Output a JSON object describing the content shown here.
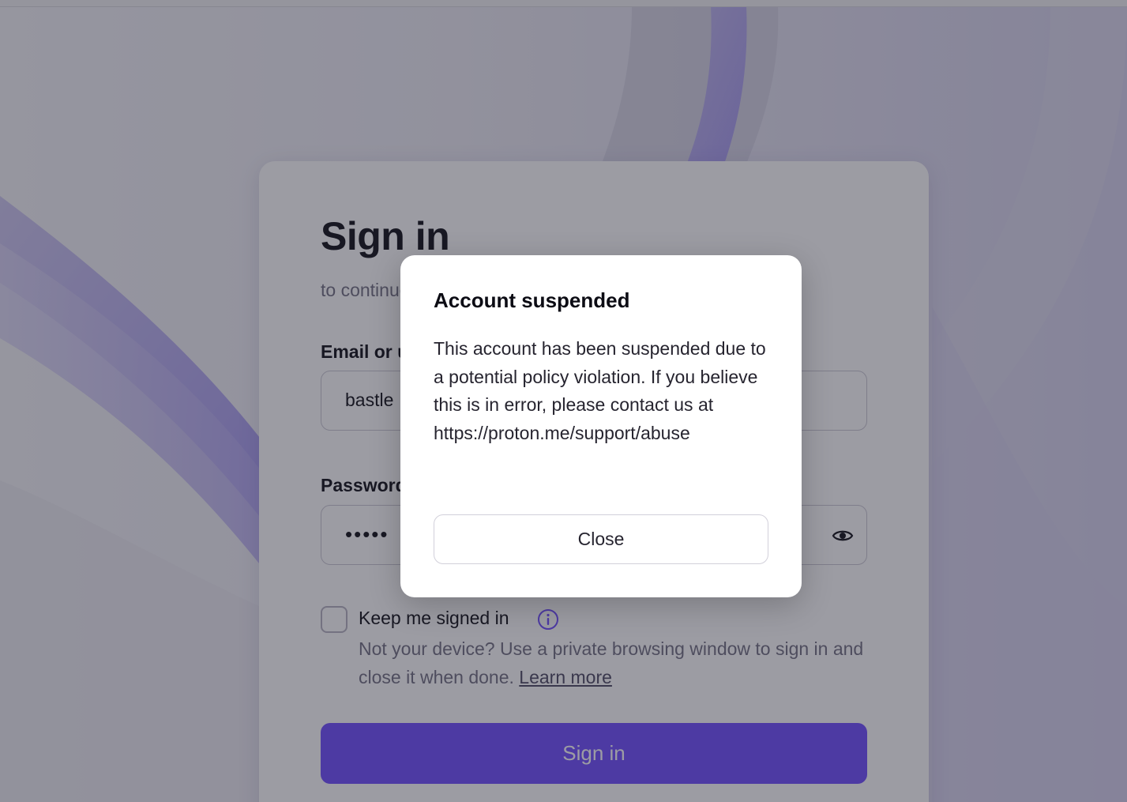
{
  "signin": {
    "title": "Sign in",
    "subtitle": "to continue to Proton",
    "email_label": "Email or username",
    "email_value": "bastle",
    "password_label": "Password",
    "password_value": "•••••",
    "keep_signed_in_label": "Keep me signed in",
    "hint_text": "Not your device? Use a private browsing window to sign in and close it when done.",
    "learn_more_label": "Learn more",
    "submit_label": "Sign in"
  },
  "modal": {
    "title": "Account suspended",
    "body": "This account has been suspended due to a potential policy violation. If you believe this is in error, please contact us at https://proton.me/support/abuse",
    "close_label": "Close"
  },
  "icons": {
    "password_toggle": "eye-icon",
    "info": "info-icon"
  },
  "colors": {
    "brand_purple": "#6d4aff",
    "info_purple": "#6d4aff"
  }
}
